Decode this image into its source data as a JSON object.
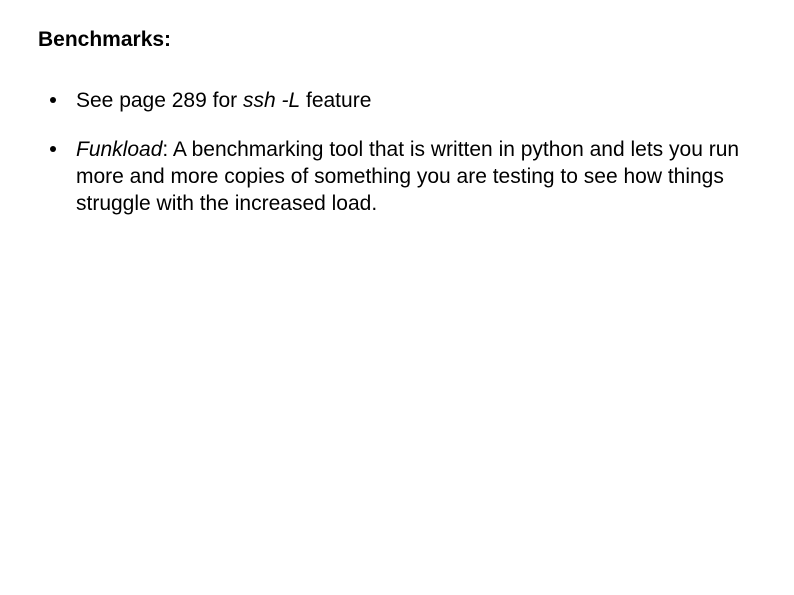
{
  "heading": "Benchmarks:",
  "items": [
    {
      "prefix": "See page 289 for ",
      "italic1": "ssh -L",
      "suffix": " feature"
    },
    {
      "italic1": "Funkload",
      "suffix": ": A benchmarking tool that is written in python and lets you run more and more copies of something you are testing  to see how things struggle with the increased load."
    }
  ]
}
